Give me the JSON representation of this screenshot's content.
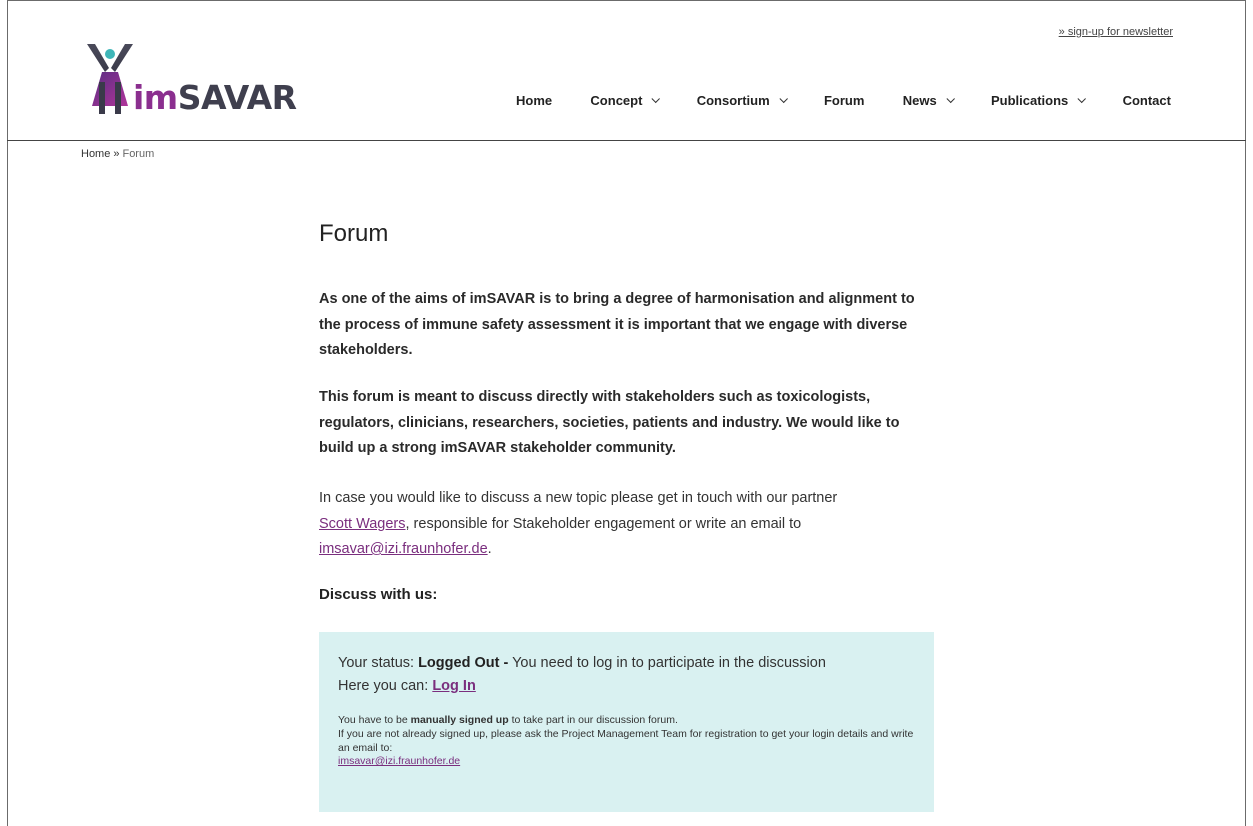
{
  "header": {
    "newsletter_link": "» sign-up for newsletter",
    "logo": {
      "im": "im",
      "savar": "SAVAR"
    }
  },
  "nav": {
    "items": [
      {
        "label": "Home",
        "has_dropdown": false
      },
      {
        "label": "Concept",
        "has_dropdown": true
      },
      {
        "label": "Consortium",
        "has_dropdown": true
      },
      {
        "label": "Forum",
        "has_dropdown": false
      },
      {
        "label": "News",
        "has_dropdown": true
      },
      {
        "label": "Publications",
        "has_dropdown": true
      },
      {
        "label": "Contact",
        "has_dropdown": false
      }
    ]
  },
  "breadcrumb": {
    "home": "Home",
    "separator": "»",
    "current": "Forum"
  },
  "page": {
    "title": "Forum",
    "intro_1": "As one of the aims of imSAVAR is to bring a degree of harmonisation and alignment to the process of immune safety assessment it is important that we engage with diverse stakeholders.",
    "intro_2": "This forum is meant to discuss directly with stakeholders such as toxicologists, regulators, clinicians, researchers, societies, patients and industry. We would like to build up a strong imSAVAR stakeholder community.",
    "contact_pre": "In case you would like to discuss a new topic please get in touch with our partner",
    "contact_person": "Scott Wagers",
    "contact_mid": ", responsible for Stakeholder engagement or write an email to",
    "contact_email": "imsavar@izi.fraunhofer.de",
    "contact_end": ".",
    "discuss_heading": "Discuss with us:"
  },
  "status_box": {
    "status_prefix": "Your status:",
    "status_value": "Logged Out -",
    "status_suffix": "You need to log in to participate in the discussion",
    "here_prefix": "Here you can:",
    "login_label": "Log In",
    "note_pre": "You have to be",
    "note_bold": "manually signed up",
    "note_post": "to take part in our discussion forum.",
    "note_line2": "If you are not already signed up, please ask the Project Management Team for registration to get your login details and write an email to:",
    "note_email": "imsavar@izi.fraunhofer.de"
  },
  "colors": {
    "accent": "#7a2e7e",
    "box_bg": "#d9f1f1",
    "logo_teal": "#3fb6b8"
  }
}
